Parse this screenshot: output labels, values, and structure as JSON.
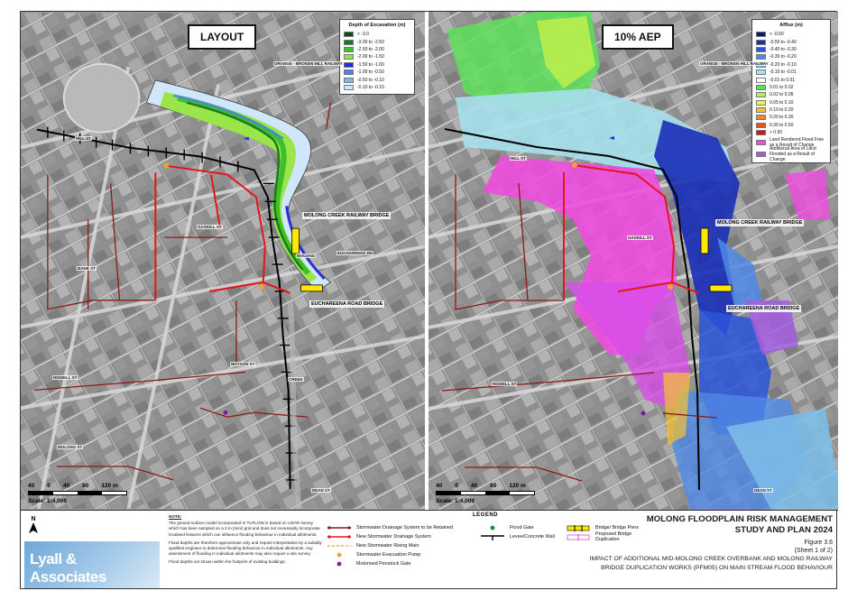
{
  "panels": {
    "left": {
      "tag": "LAYOUT",
      "legend_title": "Depth of Excavation (m)",
      "legend_items": [
        {
          "label": "< -3.0",
          "color": "#0b4d12"
        },
        {
          "label": "-3.00 to -2.50",
          "color": "#1b7a1f"
        },
        {
          "label": "-2.50 to -2.00",
          "color": "#3fbf2a"
        },
        {
          "label": "-2.00 to -1.50",
          "color": "#9ae54a"
        },
        {
          "label": "-1.50 to -1.00",
          "color": "#2a2ed6"
        },
        {
          "label": "-1.00 to -0.50",
          "color": "#4c7fe8"
        },
        {
          "label": "-0.50 to -0.10",
          "color": "#7fb3f2"
        },
        {
          "label": "-0.10 to -0.10",
          "color": "#cfe6fb"
        }
      ]
    },
    "right": {
      "tag": "10% AEP",
      "legend_title": "Afflux (m)",
      "legend_items": [
        {
          "label": "< -0.50",
          "color": "#071a6e"
        },
        {
          "label": "-0.50 to -0.40",
          "color": "#1a2fb8"
        },
        {
          "label": "-0.40 to -0.30",
          "color": "#2c55d9"
        },
        {
          "label": "-0.30 to -0.20",
          "color": "#4f88e6"
        },
        {
          "label": "-0.20 to -0.10",
          "color": "#7dbde9"
        },
        {
          "label": "-0.10 to -0.01",
          "color": "#a6e0ec"
        },
        {
          "label": "-0.01 to 0.01",
          "color": "#ffffff"
        },
        {
          "label": "0.01 to 0.02",
          "color": "#5fe05a"
        },
        {
          "label": "0.02 to 0.05",
          "color": "#b9ee4e"
        },
        {
          "label": "0.05 to 0.10",
          "color": "#eef24a"
        },
        {
          "label": "0.10 to 0.20",
          "color": "#f6c231"
        },
        {
          "label": "0.20 to 0.30",
          "color": "#f08a22"
        },
        {
          "label": "0.30 to 0.50",
          "color": "#e8501c"
        },
        {
          "label": "> 0.50",
          "color": "#d2151c"
        },
        {
          "label": "Land Rendered Flood Free as a Result of Change",
          "color": "#f04be0"
        },
        {
          "label": "Additional Area of Land Flooded as a Result of Change",
          "color": "#a35ce0"
        }
      ]
    }
  },
  "map_labels": {
    "railway_bridge": "MOLONG CREEK RAILWAY BRIDGE",
    "road_bridge": "EUCHAREENA ROAD BRIDGE",
    "orange_railway": "ORANGE - BROKEN HILL RAILWAY",
    "creek": "CREEK",
    "molong": "MOLONG",
    "streets": [
      "HILL ST",
      "GASKILL ST",
      "BANK ST",
      "RIDDELL ST",
      "MOLONG ST",
      "DEAN ST",
      "WATSON ST",
      "EUCHAREENA RD",
      "MARKET ST"
    ]
  },
  "scale": {
    "ticks": [
      "40",
      "0",
      "40",
      "80",
      "120 m"
    ],
    "label": "Scale: 1:4,000"
  },
  "north": "N",
  "logo": "Lyall & Associates",
  "note": {
    "heading": "NOTE:",
    "paragraphs": [
      "The ground surface model incorporated in TUFLOW is based on LiDAR survey which has been sampled on a 3 m (mini) grid and does not necessarily incorporate localised features which can influence flooding behaviour in individual allotments.",
      "Flood depths are therefore approximate only and require interpretation by a suitably qualified engineer to determine flooding behaviour in individual allotments. Any assessment of flooding in individual allotments may also require a site survey.",
      "Flood depths not shown within the footprint of existing buildings."
    ]
  },
  "legend": {
    "title": "LEGEND",
    "items": [
      {
        "label": "Stormwater Drainage System to be Retained",
        "symbol": "dark-red-line"
      },
      {
        "label": "New Stormwater Drainage System",
        "symbol": "red-line"
      },
      {
        "label": "New Stormwater Rising Main",
        "symbol": "orange-dash"
      },
      {
        "label": "Stormwater Evacuation Pump",
        "symbol": "orange-dot"
      },
      {
        "label": "Motorised Penstock Gate",
        "symbol": "purple-dot"
      },
      {
        "label": "Flood Gate",
        "symbol": "green-dot"
      },
      {
        "label": "Levee/Concrete Wall",
        "symbol": "black-levee"
      },
      {
        "label": "Bridge/ Bridge Piers",
        "symbol": "yellow-bridge"
      },
      {
        "label": "Proposed Bridge Duplication",
        "symbol": "pink-bridge"
      }
    ]
  },
  "title_block": {
    "title_line1": "MOLONG FLOODPLAIN RISK MANAGEMENT",
    "title_line2": "STUDY AND PLAN 2024",
    "figure": "Figure 3.6",
    "sheet": "(Sheet 1 of 2)",
    "desc_line1": "IMPACT OF ADDITIONAL MID-MOLONG CREEK OVERBANK AND MOLONG RAILWAY",
    "desc_line2": "BRIDGE DUPLICATION WORKS (PFM05) ON MAIN STREAM FLOOD BEHAVIOUR"
  },
  "colors": {
    "levee": "#000000",
    "retained_drainage": "#8b1a1a",
    "new_drainage": "#e2161c",
    "rising_main": "#f2a12e",
    "pump": "#f2a12e",
    "penstock": "#7b1fa2",
    "flood_gate": "#1b8a2a"
  }
}
